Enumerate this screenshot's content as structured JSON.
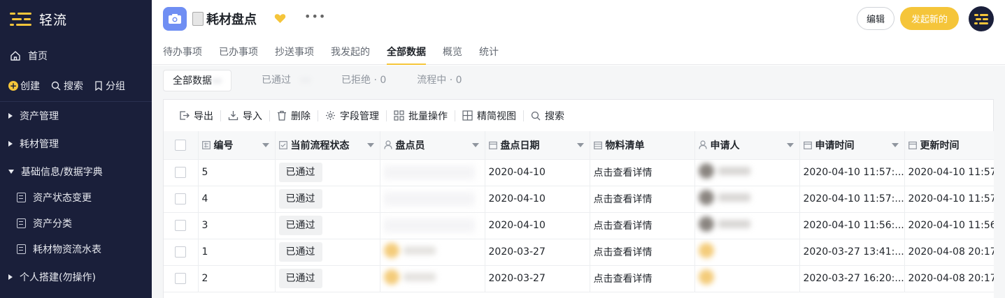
{
  "sidebar": {
    "logo_text": "轻流",
    "home": "首页",
    "actions": {
      "create": "创建",
      "search": "搜索",
      "group": "分组"
    },
    "groups": [
      {
        "label": "资产管理",
        "expanded": false
      },
      {
        "label": "耗材管理",
        "expanded": false
      },
      {
        "label": "基础信息/数据字典",
        "expanded": true
      },
      {
        "label": "个人搭建(勿操作)",
        "expanded": false
      }
    ],
    "sub_items": [
      "资产状态变更",
      "资产分类",
      "耗材物资流水表"
    ]
  },
  "header": {
    "title": "耗材盘点",
    "more": "•••",
    "edit_label": "编辑",
    "new_label": "发起新的",
    "tabs": [
      "待办事项",
      "已办事项",
      "抄送事项",
      "我发起的",
      "全部数据",
      "概览",
      "统计"
    ],
    "active_tab": "全部数据"
  },
  "filters": [
    {
      "label": "全部数据",
      "active": true
    },
    {
      "label": "已通过",
      "active": false
    },
    {
      "label": "已拒绝 · 0",
      "active": false
    },
    {
      "label": "流程中 · 0",
      "active": false
    }
  ],
  "toolbar": {
    "export": "导出",
    "import": "导入",
    "delete": "删除",
    "fields": "字段管理",
    "batch": "批量操作",
    "compact": "精简视图",
    "search": "搜索"
  },
  "table": {
    "columns": [
      "编号",
      "当前流程状态",
      "盘点员",
      "盘点日期",
      "物料清单",
      "申请人",
      "申请时间",
      "更新时间"
    ],
    "rows": [
      {
        "id": "5",
        "status": "已通过",
        "date": "2020-04-10",
        "list": "点击查看详情",
        "applied": "2020-04-10 11:57:...",
        "updated": "2020-04-10 11:57:"
      },
      {
        "id": "4",
        "status": "已通过",
        "date": "2020-04-10",
        "list": "点击查看详情",
        "applied": "2020-04-10 11:57:...",
        "updated": "2020-04-10 11:57:"
      },
      {
        "id": "3",
        "status": "已通过",
        "date": "2020-04-10",
        "list": "点击查看详情",
        "applied": "2020-04-10 11:56:...",
        "updated": "2020-04-10 11:56:"
      },
      {
        "id": "1",
        "status": "已通过",
        "date": "2020-03-27",
        "list": "点击查看详情",
        "applied": "2020-03-27 13:41:...",
        "updated": "2020-04-08 20:17:"
      },
      {
        "id": "2",
        "status": "已通过",
        "date": "2020-03-27",
        "list": "点击查看详情",
        "applied": "2020-03-27 16:20:...",
        "updated": "2020-04-08 20:17:"
      }
    ]
  },
  "colors": {
    "sidebar_bg": "#1a1f3a",
    "accent": "#f5c53a",
    "app_icon": "#6f8ef3"
  }
}
